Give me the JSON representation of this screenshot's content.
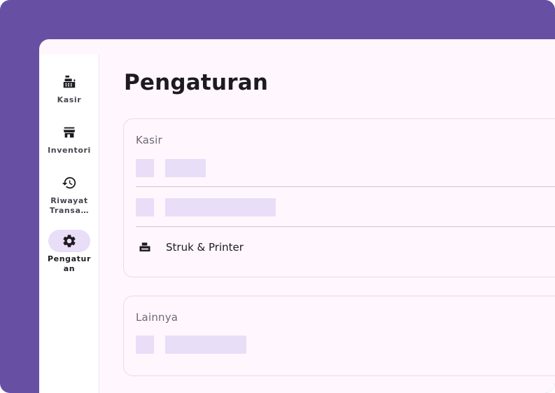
{
  "theme": {
    "accent": "#6750A4",
    "surface": "#FFF7FD",
    "indicator": "#E8DEF8",
    "outline": "#CAC4D0"
  },
  "nav": {
    "items": [
      {
        "label": "Kasir",
        "icon": "cash-register-icon",
        "active": false
      },
      {
        "label": "Inventori",
        "icon": "store-icon",
        "active": false
      },
      {
        "label": "Riwayat Transa…",
        "icon": "history-icon",
        "active": false
      },
      {
        "label": "Pengaturan",
        "icon": "gear-icon",
        "active": true
      }
    ]
  },
  "page": {
    "title": "Pengaturan"
  },
  "sections": [
    {
      "title": "Kasir",
      "rows": [
        {
          "label": "",
          "icon": "placeholder"
        },
        {
          "label": "",
          "icon": "placeholder"
        },
        {
          "label": "Struk & Printer",
          "icon": "printer-icon"
        }
      ]
    },
    {
      "title": "Lainnya",
      "rows": [
        {
          "label": "",
          "icon": "placeholder"
        }
      ]
    }
  ]
}
